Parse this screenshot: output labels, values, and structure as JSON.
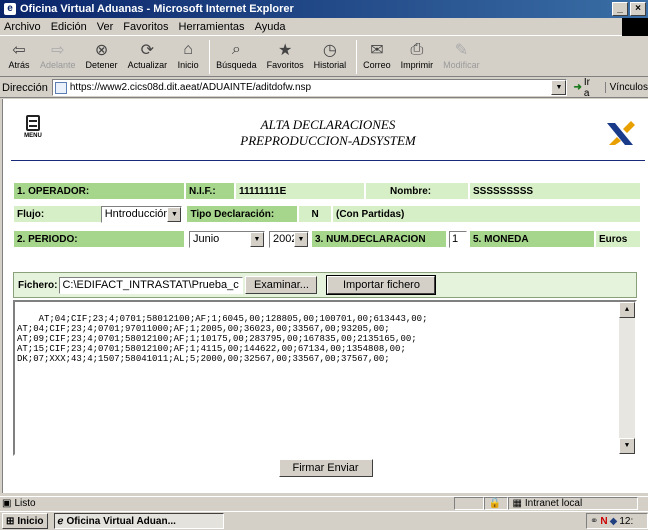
{
  "window": {
    "title": "Oficina Virtual Aduanas - Microsoft Internet Explorer",
    "minimize": "_",
    "close": "×"
  },
  "menu": {
    "items": [
      {
        "label": "Archivo",
        "key": "A"
      },
      {
        "label": "Edición",
        "key": "E"
      },
      {
        "label": "Ver",
        "key": "V"
      },
      {
        "label": "Favoritos",
        "key": "F"
      },
      {
        "label": "Herramientas",
        "key": "H"
      },
      {
        "label": "Ayuda",
        "key": "y"
      }
    ]
  },
  "toolbar": {
    "back": "Atrás",
    "forward": "Adelante",
    "stop": "Detener",
    "refresh": "Actualizar",
    "home": "Inicio",
    "search": "Búsqueda",
    "favorites": "Favoritos",
    "history": "Historial",
    "mail": "Correo",
    "print": "Imprimir",
    "edit": "Modificar"
  },
  "address": {
    "label": "Dirección",
    "url": "https://www2.cics08d.dit.aeat/ADUAINTE/aditdofw.nsp",
    "go": "Ir a",
    "links": "Vínculos"
  },
  "page": {
    "menu_label": "MENU",
    "title_line1": "ALTA DECLARACIONES",
    "title_line2": "PREPRODUCCION-ADSYSTEM"
  },
  "form": {
    "operador_label": "1. OPERADOR:",
    "nif_label": "N.I.F.:",
    "nif_value": "11111111E",
    "nombre_label": "Nombre:",
    "nombre_value": "SSSSSSSSS",
    "flujo_label": "Flujo:",
    "flujo_value": "Hntroducción",
    "tipo_label": "Tipo Declaración:",
    "tipo_value": "N",
    "tipo_desc": "(Con Partidas)",
    "periodo_label": "2. PERIODO:",
    "mes_value": "Junio",
    "anio_value": "2002",
    "numdecl_label": "3. NUM.DECLARACION",
    "numdecl_value": "1",
    "moneda_label": "5. MONEDA",
    "moneda_value": "Euros",
    "fichero_label": "Fichero:",
    "fichero_value": "C:\\EDIFACT_INTRASTAT\\Prueba_c",
    "examinar_label": "Examinar...",
    "importar_label": "Importar fichero",
    "textarea_content": "AT;04;CIF;23;4;0701;58012100;AF;1;6045,00;128805,00;100701,00;613443,00;\nAT;04;CIF;23;4;0701;97011000;AF;1;2005,00;36023,00;33567,00;93205,00;\nAT;09;CIF;23;4;0701;58012100;AF;1;10175,00;283795,00;167835,00;2135165,00;\nAT;15;CIF;23;4;0701;58012100;AF;1;4115,00;144622,00;67134,00;1354808,00;\nDK;07;XXX;43;4;1507;58041011;AL;5;2000,00;32567,00;33567,00;37567,00;",
    "submit_label": "Firmar Enviar"
  },
  "status": {
    "text": "Listo",
    "zone": "Intranet local"
  },
  "taskbar": {
    "start": "Inicio",
    "task": "Oficina Virtual Aduan...",
    "clock": "12:"
  }
}
